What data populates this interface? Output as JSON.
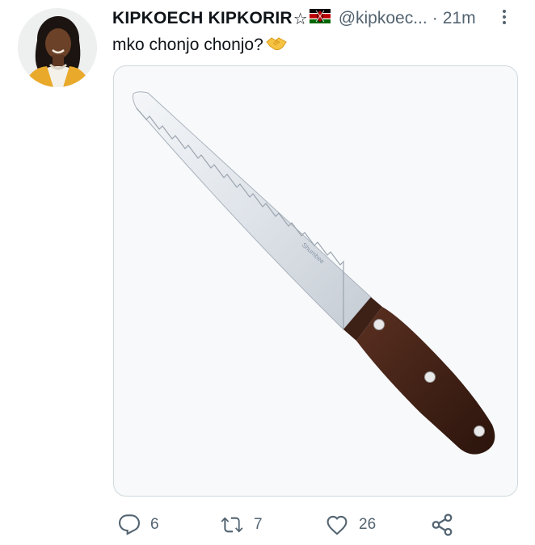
{
  "tweet": {
    "author_name": "KIPKOECH KIPKORIR",
    "star_glyph": "☆",
    "handle": "@kipkoec...",
    "separator": "·",
    "time": "21m",
    "text": "mko chonjo chonjo?",
    "emoji_icon": "handshake-icon",
    "flag_icon": "kenya-flag-icon",
    "media": {
      "description_icon": "bread-knife-image",
      "blade_text": "Shumbee"
    }
  },
  "actions": {
    "reply_count": "6",
    "retweet_count": "7",
    "like_count": "26"
  },
  "colors": {
    "text_primary": "#0f1419",
    "text_secondary": "#536471",
    "border": "#cfd9de",
    "avatar_jacket": "#e9a92a"
  }
}
